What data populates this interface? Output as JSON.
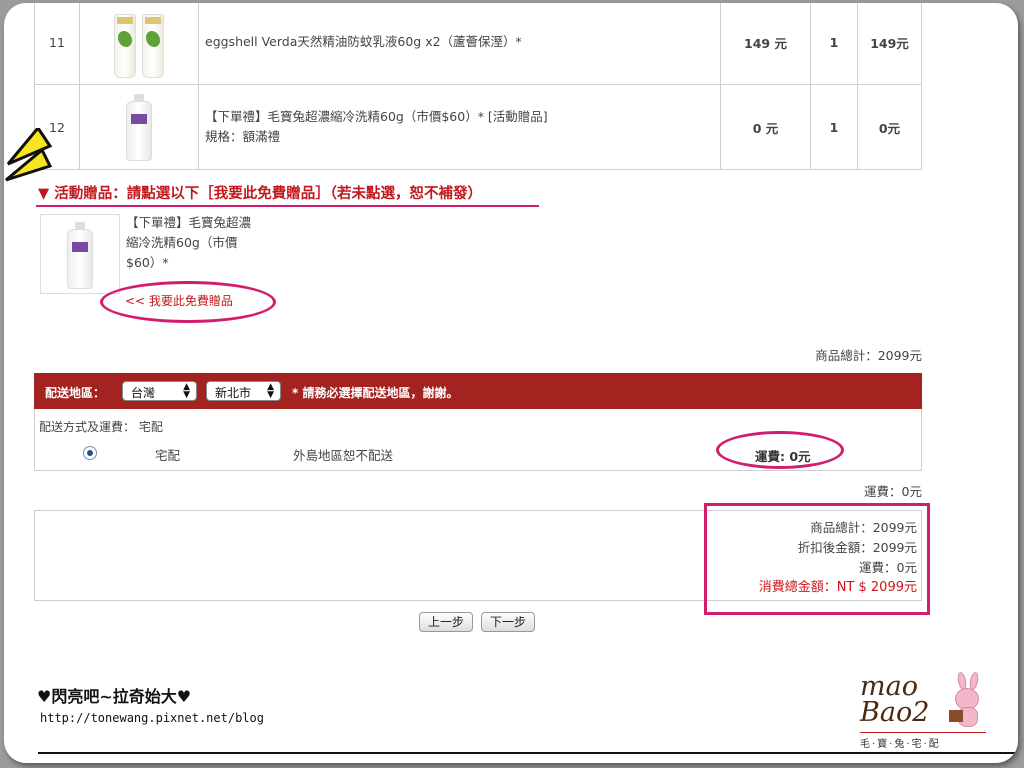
{
  "products": [
    {
      "no": "11",
      "name": "eggshell Verda天然精油防蚊乳液60g x2（蘆薈保溼）*",
      "spec": "",
      "price": "149 元",
      "qty": "1",
      "subtotal": "149元"
    },
    {
      "no": "12",
      "name": "【下單禮】毛寶兔超濃縮冷洗精60g（市價$60）* [活動贈品]",
      "spec": "規格：額滿禮",
      "price": "0 元",
      "qty": "1",
      "subtotal": "0元"
    }
  ],
  "gift": {
    "heading": "▼ 活動贈品：請點選以下［我要此免費贈品］（若未點選，恕不補發）",
    "name": "【下單禮】毛寶兔超濃縮冷洗精60g（市價$60）*",
    "link": "<< 我要此免費贈品"
  },
  "subtotal_top": "商品總計：2099元",
  "shipping": {
    "region_label": "配送地區：",
    "region_1": "台灣",
    "region_2": "新北市",
    "region_note": "* 請務必選擇配送地區，謝謝。",
    "method_title": "配送方式及運費： 宅配",
    "method": "宅配",
    "method_note": "外島地區恕不配送",
    "method_fee": "運費: 0元"
  },
  "fee_line": "運費：0元",
  "summary": {
    "goods_total": "商品總計：2099元",
    "after_discount": "折扣後金額：2099元",
    "shipping": "運費：0元",
    "grand_total": "消費總金額：NT $ 2099元"
  },
  "buttons": {
    "prev": "上一步",
    "next": "下一步"
  },
  "watermark": {
    "title": "♥閃亮吧~拉奇始大♥",
    "url": "http://tonewang.pixnet.net/blog"
  },
  "logo": {
    "line1": "mao",
    "line2": "Bao2",
    "tagline": "毛‧寶‧兔‧宅‧配"
  },
  "colors": {
    "accent_red": "#a32320",
    "highlight_pink": "#d21d6e",
    "total_red": "#d0151b"
  }
}
